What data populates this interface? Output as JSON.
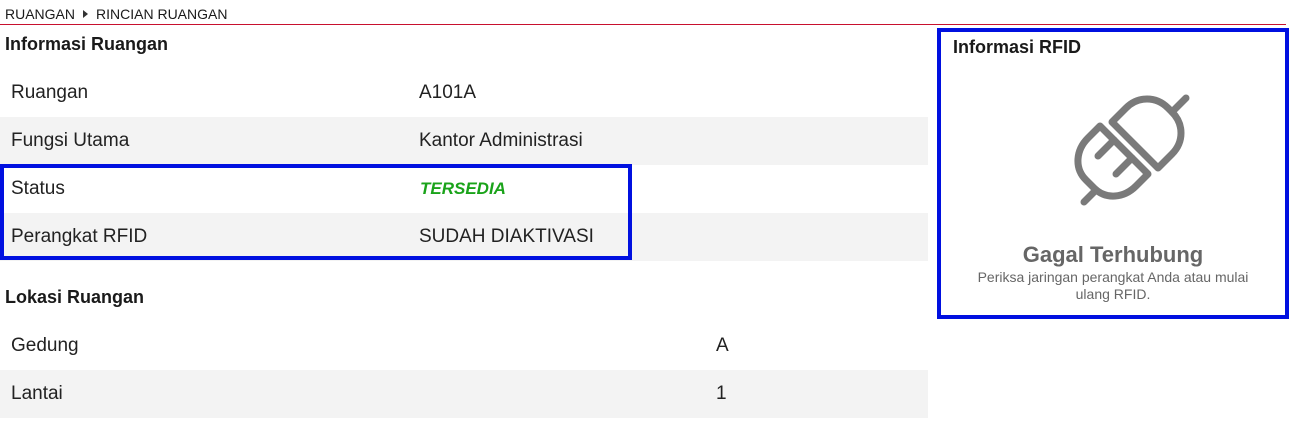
{
  "breadcrumb": {
    "root": "RUANGAN",
    "current": "RINCIAN RUANGAN"
  },
  "room_info": {
    "title": "Informasi Ruangan",
    "rows": [
      {
        "label": "Ruangan",
        "value": "A101A"
      },
      {
        "label": "Fungsi Utama",
        "value": "Kantor Administrasi"
      },
      {
        "label": "Status",
        "value": "TERSEDIA"
      },
      {
        "label": "Perangkat RFID",
        "value": "SUDAH DIAKTIVASI"
      }
    ]
  },
  "location": {
    "title": "Lokasi Ruangan",
    "rows": [
      {
        "label": "Gedung",
        "value": "A"
      },
      {
        "label": "Lantai",
        "value": "1"
      }
    ]
  },
  "rfid": {
    "title": "Informasi RFID",
    "icon": "disconnected-plug-icon",
    "status_title": "Gagal Terhubung",
    "status_desc": "Periksa jaringan perangkat Anda atau mulai ulang RFID."
  },
  "colors": {
    "accent_rule": "#c8102e",
    "highlight": "#0010e0",
    "available": "#1aa31a",
    "muted": "#666666"
  }
}
